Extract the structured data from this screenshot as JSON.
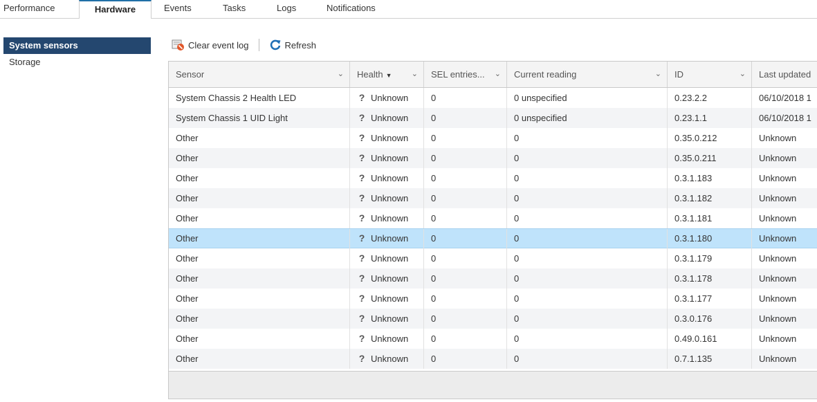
{
  "tabs": [
    "Performance",
    "Hardware",
    "Events",
    "Tasks",
    "Logs",
    "Notifications"
  ],
  "left_nav": [
    "System sensors",
    "Storage"
  ],
  "toolbar": {
    "clear_label": "Clear event log",
    "refresh_label": "Refresh"
  },
  "columns": [
    "Sensor",
    "Health",
    "SEL entries...",
    "Current reading",
    "ID",
    "Last updated"
  ],
  "rows": [
    [
      "System Chassis 2 Health LED",
      "Unknown",
      "0",
      "0 unspecified",
      "0.23.2.2",
      "06/10/2018 1"
    ],
    [
      "System Chassis 1 UID Light",
      "Unknown",
      "0",
      "0 unspecified",
      "0.23.1.1",
      "06/10/2018 1"
    ],
    [
      "Other",
      "Unknown",
      "0",
      "0",
      "0.35.0.212",
      "Unknown"
    ],
    [
      "Other",
      "Unknown",
      "0",
      "0",
      "0.35.0.211",
      "Unknown"
    ],
    [
      "Other",
      "Unknown",
      "0",
      "0",
      "0.3.1.183",
      "Unknown"
    ],
    [
      "Other",
      "Unknown",
      "0",
      "0",
      "0.3.1.182",
      "Unknown"
    ],
    [
      "Other",
      "Unknown",
      "0",
      "0",
      "0.3.1.181",
      "Unknown"
    ],
    [
      "Other",
      "Unknown",
      "0",
      "0",
      "0.3.1.180",
      "Unknown"
    ],
    [
      "Other",
      "Unknown",
      "0",
      "0",
      "0.3.1.179",
      "Unknown"
    ],
    [
      "Other",
      "Unknown",
      "0",
      "0",
      "0.3.1.178",
      "Unknown"
    ],
    [
      "Other",
      "Unknown",
      "0",
      "0",
      "0.3.1.177",
      "Unknown"
    ],
    [
      "Other",
      "Unknown",
      "0",
      "0",
      "0.3.0.176",
      "Unknown"
    ],
    [
      "Other",
      "Unknown",
      "0",
      "0",
      "0.49.0.161",
      "Unknown"
    ],
    [
      "Other",
      "Unknown",
      "0",
      "0",
      "0.7.1.135",
      "Unknown"
    ]
  ],
  "selected_row": 7,
  "colors": {
    "nav_selected": "#24476f",
    "row_selected": "#bfe3fb",
    "refresh_icon": "#1f6fb5"
  },
  "icons": {
    "health_unknown": "question-mark-icon",
    "clear": "clear-log-icon",
    "refresh": "refresh-icon"
  }
}
